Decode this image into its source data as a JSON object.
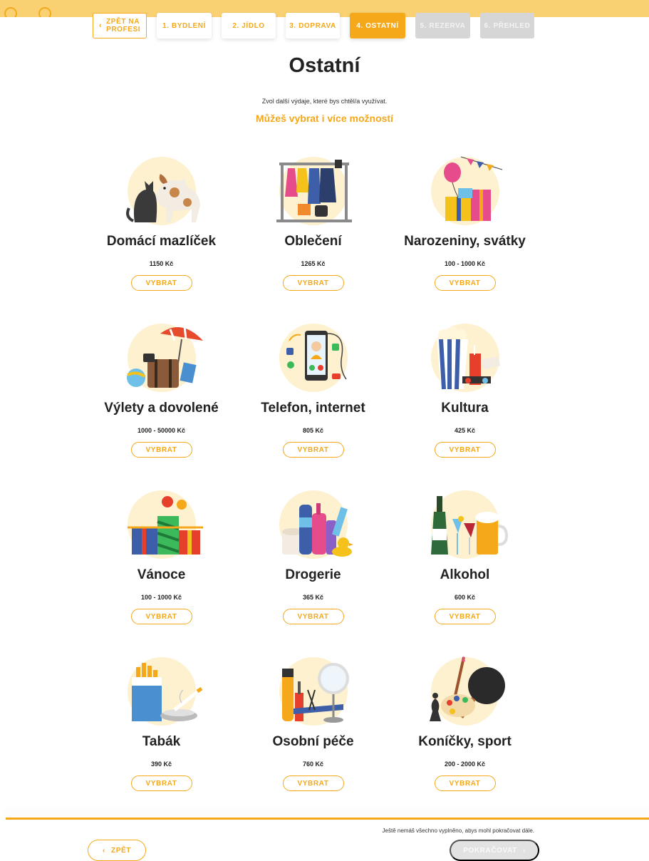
{
  "stepper": {
    "back": {
      "line1": "ZPĚT NA",
      "line2": "PROFESI"
    },
    "steps": [
      {
        "label": "1. BYDLENÍ",
        "state": "done"
      },
      {
        "label": "2. JÍDLO",
        "state": "done"
      },
      {
        "label": "3. DOPRAVA",
        "state": "done"
      },
      {
        "label": "4. OSTATNÍ",
        "state": "active"
      },
      {
        "label": "5. REZERVA",
        "state": "disabled"
      },
      {
        "label": "6. PŘEHLED",
        "state": "disabled"
      }
    ]
  },
  "page": {
    "title": "Ostatní",
    "subtitle": "Zvol další výdaje, které bys chtěl/a využívat.",
    "highlight": "Můžeš vybrat i více možností"
  },
  "select_label": "VYBRAT",
  "cards": [
    {
      "name": "Domácí mazlíček",
      "price": "1150 Kč",
      "icon": "pets-icon"
    },
    {
      "name": "Oblečení",
      "price": "1265 Kč",
      "icon": "clothes-rack-icon"
    },
    {
      "name": "Narozeniny, svátky",
      "price": "100 - 1000 Kč",
      "icon": "birthday-gifts-icon"
    },
    {
      "name": "Výlety a dovolené",
      "price": "1000 - 50000 Kč",
      "icon": "travel-suitcase-icon"
    },
    {
      "name": "Telefon, internet",
      "price": "805 Kč",
      "icon": "smartphone-icon"
    },
    {
      "name": "Kultura",
      "price": "425 Kč",
      "icon": "popcorn-cinema-icon"
    },
    {
      "name": "Vánoce",
      "price": "100 - 1000 Kč",
      "icon": "christmas-gifts-icon"
    },
    {
      "name": "Drogerie",
      "price": "365 Kč",
      "icon": "toiletries-icon"
    },
    {
      "name": "Alkohol",
      "price": "600 Kč",
      "icon": "alcohol-drinks-icon"
    },
    {
      "name": "Tabák",
      "price": "390 Kč",
      "icon": "cigarettes-icon"
    },
    {
      "name": "Osobní péče",
      "price": "760 Kč",
      "icon": "personal-care-icon"
    },
    {
      "name": "Koníčky, sport",
      "price": "200 - 2000 Kč",
      "icon": "hobby-sport-icon"
    }
  ],
  "footer": {
    "message": "Ještě nemáš všechno vyplněno, abys mohl pokračovat dále.",
    "back_label": "ZPĚT",
    "next_label": "POKRAČOVAT"
  },
  "colors": {
    "accent": "#f4a81a",
    "disabled": "#d6d6d6",
    "illus_bg": "#fdf1cf"
  }
}
